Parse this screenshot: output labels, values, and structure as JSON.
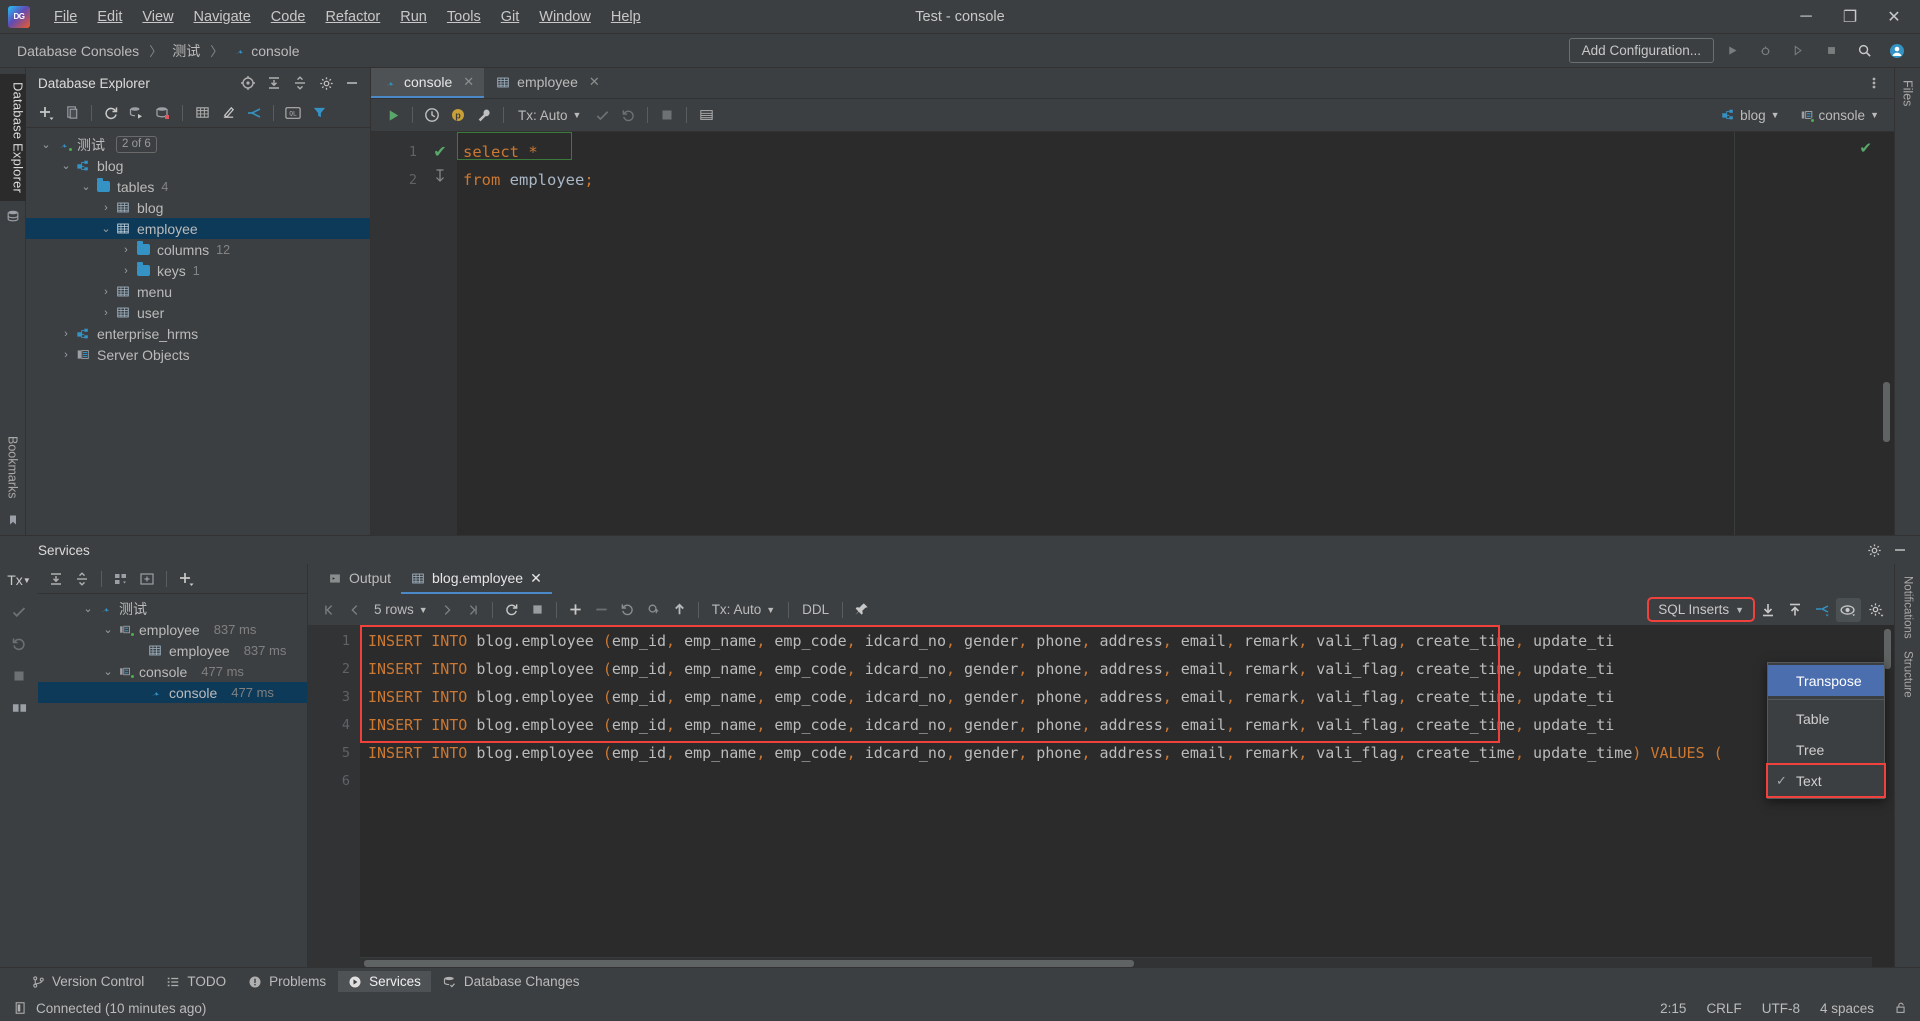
{
  "window": {
    "title": "Test - console",
    "logo_text": "DG",
    "minimize": "─",
    "maximize": "❐",
    "close": "✕"
  },
  "menubar": {
    "items": [
      {
        "label": "File"
      },
      {
        "label": "Edit"
      },
      {
        "label": "View"
      },
      {
        "label": "Navigate"
      },
      {
        "label": "Code"
      },
      {
        "label": "Refactor"
      },
      {
        "label": "Run"
      },
      {
        "label": "Tools"
      },
      {
        "label": "Git"
      },
      {
        "label": "Window"
      },
      {
        "label": "Help"
      }
    ]
  },
  "breadcrumb": {
    "root": "Database Consoles",
    "db": "测试",
    "file": "console",
    "separator": "〉"
  },
  "navbar": {
    "add_configuration": "Add Configuration...",
    "icons": [
      "run-icon",
      "debug-icon",
      "run-coverage-icon",
      "stop-icon",
      "search-everywhere-icon",
      "account-icon"
    ]
  },
  "database_explorer": {
    "title": "Database Explorer",
    "header_icons": [
      "locate-icon",
      "expand-all-icon",
      "collapse-all-icon",
      "settings-icon",
      "hide-icon"
    ],
    "toolbar_icons": [
      "add-icon",
      "copy-icon",
      "refresh-icon",
      "run-script-icon",
      "database-diff-icon",
      "table-editor-icon",
      "modify-icon",
      "jump-to-icon",
      "query-console-icon",
      "filter-icon"
    ],
    "tree": [
      {
        "label": "测试",
        "badge": "2 of 6",
        "indent": 0,
        "twisty": "⌄",
        "icon": "mysql-icon",
        "count": "",
        "selected": false
      },
      {
        "label": "blog",
        "badge": "",
        "indent": 1,
        "twisty": "⌄",
        "icon": "schema-icon",
        "count": "",
        "selected": false
      },
      {
        "label": "tables",
        "badge": "",
        "indent": 2,
        "twisty": "⌄",
        "icon": "folder-icon",
        "count": "4",
        "selected": false
      },
      {
        "label": "blog",
        "badge": "",
        "indent": 3,
        "twisty": "›",
        "icon": "table-icon",
        "count": "",
        "selected": false
      },
      {
        "label": "employee",
        "badge": "",
        "indent": 3,
        "twisty": "⌄",
        "icon": "table-icon",
        "count": "",
        "selected": true
      },
      {
        "label": "columns",
        "badge": "",
        "indent": 4,
        "twisty": "›",
        "icon": "folder-icon",
        "count": "12",
        "selected": false
      },
      {
        "label": "keys",
        "badge": "",
        "indent": 4,
        "twisty": "›",
        "icon": "folder-icon",
        "count": "1",
        "selected": false
      },
      {
        "label": "menu",
        "badge": "",
        "indent": 3,
        "twisty": "›",
        "icon": "table-icon",
        "count": "",
        "selected": false
      },
      {
        "label": "user",
        "badge": "",
        "indent": 3,
        "twisty": "›",
        "icon": "table-icon",
        "count": "",
        "selected": false
      },
      {
        "label": "enterprise_hrms",
        "badge": "",
        "indent": 1,
        "twisty": "›",
        "icon": "schema-icon",
        "count": "",
        "selected": false
      },
      {
        "label": "Server Objects",
        "badge": "",
        "indent": 1,
        "twisty": "›",
        "icon": "server-objects-icon",
        "count": "",
        "selected": false
      }
    ]
  },
  "editor": {
    "tabs": [
      {
        "label": "console",
        "icon": "mysql-icon",
        "active": true,
        "closable": true
      },
      {
        "label": "employee",
        "icon": "table-icon",
        "active": false,
        "closable": true
      }
    ],
    "toolbar": {
      "tx_label": "Tx: Auto",
      "icons": [
        "execute-icon",
        "history-icon",
        "p-icon",
        "wrench-icon",
        "commit-icon",
        "rollback-icon",
        "stop-icon",
        "grid-icon"
      ]
    },
    "schema_chip": "blog",
    "session_chip": "console",
    "lines": [
      {
        "num": "1",
        "status": "✔",
        "tokens": [
          {
            "t": "select",
            "c": "kw"
          },
          {
            "t": " ",
            "c": "plain"
          },
          {
            "t": "*",
            "c": "kw"
          }
        ]
      },
      {
        "num": "2",
        "status": "",
        "tokens": [
          {
            "t": "from",
            "c": "kw"
          },
          {
            "t": " employee",
            "c": "plain"
          },
          {
            "t": ";",
            "c": "kw"
          }
        ]
      }
    ]
  },
  "services": {
    "title": "Services",
    "header_icons": [
      "settings-icon",
      "hide-icon"
    ],
    "rail_icons": [
      "tx-icon",
      "commit-icon",
      "rollback-icon",
      "stop-icon",
      "layout-icon"
    ],
    "toolbar_icons": [
      "expand-all-icon",
      "collapse-all-icon",
      "group-icon",
      "add-panel-icon",
      "add-icon"
    ],
    "tree": [
      {
        "label": "测试",
        "time": "",
        "indent": 0,
        "twisty": "⌄",
        "icon": "mysql-icon",
        "selected": false
      },
      {
        "label": "employee",
        "time": "837 ms",
        "indent": 1,
        "twisty": "⌄",
        "icon": "session-icon",
        "selected": false
      },
      {
        "label": "employee",
        "time": "837 ms",
        "indent": 2,
        "twisty": "",
        "icon": "table-icon",
        "selected": false
      },
      {
        "label": "console",
        "time": "477 ms",
        "indent": 1,
        "twisty": "⌄",
        "icon": "session-icon",
        "selected": false
      },
      {
        "label": "console",
        "time": "477 ms",
        "indent": 2,
        "twisty": "",
        "icon": "mysql-icon",
        "selected": true
      }
    ],
    "result_tabs": [
      {
        "label": "Output",
        "icon": "output-icon",
        "active": false,
        "closable": false
      },
      {
        "label": "blog.employee",
        "icon": "table-icon",
        "active": true,
        "closable": true
      }
    ],
    "result_toolbar": {
      "rows_label": "5 rows",
      "tx_label": "Tx: Auto",
      "ddl_label": "DDL",
      "nav_icons": [
        "first-page-icon",
        "prev-page-icon",
        "next-page-icon",
        "last-page-icon"
      ],
      "action_icons": [
        "refresh-icon",
        "stop-icon",
        "add-row-icon",
        "delete-row-icon",
        "revert-icon",
        "revert-selected-icon",
        "submit-icon",
        "pin-icon"
      ],
      "export_label": "SQL Inserts",
      "right_icons": [
        "download-icon",
        "upload-icon",
        "compare-icon",
        "view-mode-icon",
        "settings-icon"
      ]
    },
    "result_rows": [
      {
        "num": "1",
        "text": "INSERT INTO blog.employee (emp_id, emp_name, emp_code, idcard_no, gender, phone, address, email, remark, vali_flag, create_time, update_ti"
      },
      {
        "num": "2",
        "text": "INSERT INTO blog.employee (emp_id, emp_name, emp_code, idcard_no, gender, phone, address, email, remark, vali_flag, create_time, update_ti"
      },
      {
        "num": "3",
        "text": "INSERT INTO blog.employee (emp_id, emp_name, emp_code, idcard_no, gender, phone, address, email, remark, vali_flag, create_time, update_ti"
      },
      {
        "num": "4",
        "text": "INSERT INTO blog.employee (emp_id, emp_name, emp_code, idcard_no, gender, phone, address, email, remark, vali_flag, create_time, update_ti"
      },
      {
        "num": "5",
        "text": "INSERT INTO blog.employee (emp_id, emp_name, emp_code, idcard_no, gender, phone, address, email, remark, vali_flag, create_time, update_time) VALUES ("
      },
      {
        "num": "6",
        "text": ""
      }
    ]
  },
  "context_menu": {
    "items": [
      {
        "label": "Transpose",
        "checked": false,
        "highlighted": true,
        "separator_after": true
      },
      {
        "label": "Table",
        "checked": false,
        "highlighted": false,
        "separator_after": false
      },
      {
        "label": "Tree",
        "checked": false,
        "highlighted": false,
        "separator_after": false
      },
      {
        "label": "Text",
        "checked": true,
        "highlighted": false,
        "separator_after": false
      }
    ]
  },
  "toolwindow_bar": {
    "items": [
      {
        "label": "Version Control",
        "icon": "branch-icon",
        "active": false
      },
      {
        "label": "TODO",
        "icon": "list-icon",
        "active": false
      },
      {
        "label": "Problems",
        "icon": "warning-icon",
        "active": false
      },
      {
        "label": "Services",
        "icon": "services-icon",
        "active": true
      },
      {
        "label": "Database Changes",
        "icon": "db-changes-icon",
        "active": false
      }
    ]
  },
  "statusbar": {
    "connection": "Connected (10 minutes ago)",
    "caret": "2:15",
    "line_sep": "CRLF",
    "encoding": "UTF-8",
    "indent": "4 spaces",
    "lock": "🔓"
  },
  "rails": {
    "left_top": "Database Explorer",
    "left_bottom": "Bookmarks",
    "right_top": "Files",
    "right_b1": "Notifications",
    "right_b2": "Structure"
  },
  "colors": {
    "accent": "#4a88c7",
    "selection": "#0d3a58",
    "highlight": "#4b6eaf",
    "red_box": "#f0413d",
    "keyword": "#cc7832",
    "identifier": "#a9b7c6",
    "green": "#59a869"
  }
}
